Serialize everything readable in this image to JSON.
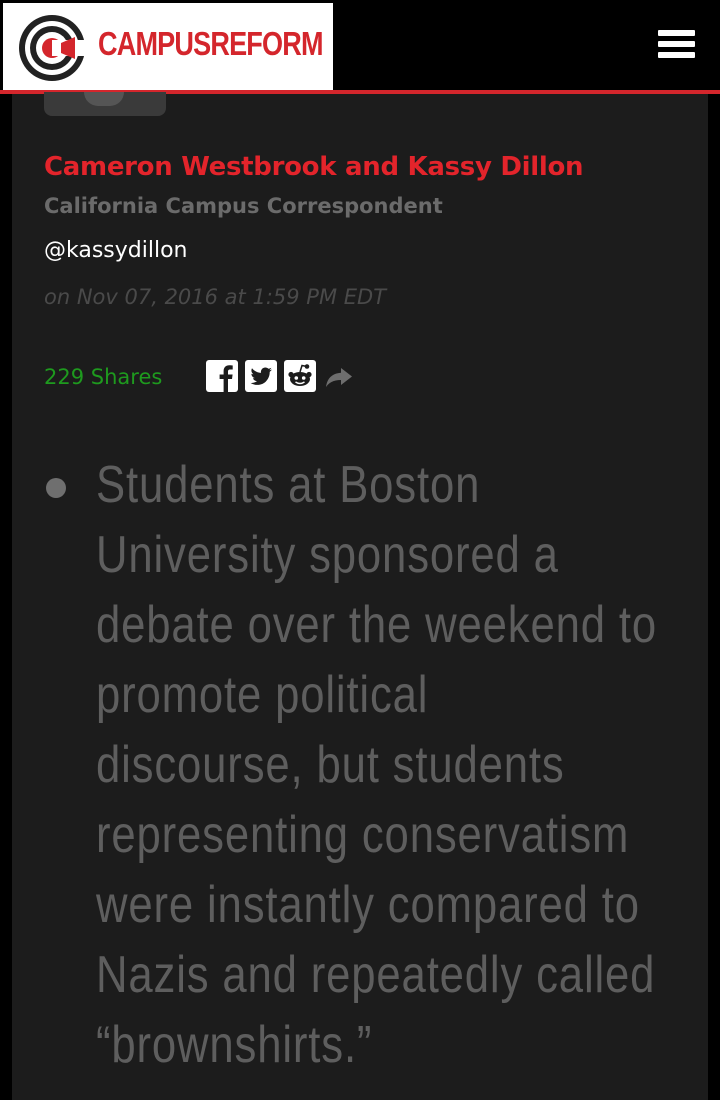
{
  "header": {
    "brand": "CAMPUSREFORM",
    "brand_color": "#d4262c",
    "menu_icon": "hamburger-menu-icon"
  },
  "article": {
    "author": "Cameron Westbrook and Kassy Dillon",
    "role": "California Campus Correspondent",
    "handle": "@kassydillon",
    "date": "on Nov 07, 2016 at 1:59 PM EDT",
    "shares": "229 Shares",
    "share_icons": [
      "facebook-icon",
      "twitter-icon",
      "reddit-icon",
      "share-arrow-icon"
    ],
    "summary_lines": [
      "Students at Boston",
      "University sponsored a",
      "debate over the weekend to",
      "promote political",
      "discourse, but students",
      "representing conservatism",
      "were instantly compared to",
      "Nazis and repeatedly called",
      "“brownshirts.”"
    ]
  },
  "colors": {
    "accent_red": "#e3242b",
    "shares_green": "#1e9a1e",
    "background": "#1c1c1c"
  }
}
